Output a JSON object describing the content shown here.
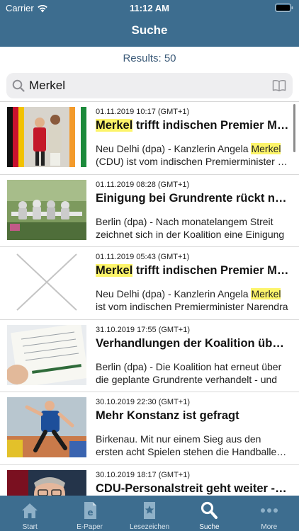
{
  "status_bar": {
    "carrier": "Carrier",
    "time": "11:12 AM"
  },
  "header": {
    "title": "Suche"
  },
  "results": {
    "label": "Results: 50"
  },
  "search": {
    "value": "Merkel"
  },
  "articles": [
    {
      "date": "01.11.2019 10:17 (GMT+1)",
      "title_hl": "Merkel",
      "title_rest": " trifft indischen Premier Modi",
      "excerpt1_pre": "Neu Delhi (dpa) - Kanzlerin Angela ",
      "excerpt1_hl": "Merkel",
      "excerpt2": "(CDU) ist vom indischen Premierminister Narendra"
    },
    {
      "date": "01.11.2019 08:28 (GMT+1)",
      "title_rest": "Einigung bei Grundrente rückt näher",
      "excerpt1_pre": "Berlin (dpa) - Nach monatelangem Streit",
      "excerpt2": "zeichnet sich in der Koalition eine Einigung"
    },
    {
      "date": "01.11.2019 05:43 (GMT+1)",
      "title_hl": "Merkel",
      "title_rest": " trifft indischen Premier Modi",
      "excerpt1_pre": "Neu Delhi (dpa) - Kanzlerin Angela ",
      "excerpt1_hl": "Merkel",
      "excerpt2": "ist vom indischen Premierminister Narendra"
    },
    {
      "date": "31.10.2019 17:55 (GMT+1)",
      "title_rest": "Verhandlungen der Koalition über Grundrente",
      "excerpt1_pre": "Berlin (dpa) - Die Koalition hat erneut über",
      "excerpt2": "die geplante Grundrente verhandelt - und"
    },
    {
      "date": "30.10.2019 22:30 (GMT+1)",
      "title_rest": "Mehr Konstanz ist gefragt",
      "excerpt1_pre": "Birkenau. Mit nur einem Sieg aus den",
      "excerpt2": "ersten acht Spielen stehen die Handballerinnen"
    },
    {
      "date": "30.10.2019 18:17 (GMT+1)",
      "title_rest": "CDU-Personalstreit geht weiter - Merz",
      "excerpt1_pre": "",
      "excerpt2": ""
    }
  ],
  "tabbar": {
    "items": [
      {
        "label": "Start",
        "icon": "home-icon"
      },
      {
        "label": "E-Paper",
        "icon": "epaper-icon"
      },
      {
        "label": "Lesezeichen",
        "icon": "bookmark-icon"
      },
      {
        "label": "Suche",
        "icon": "search-icon"
      },
      {
        "label": "More",
        "icon": "more-icon"
      }
    ]
  },
  "colors": {
    "primary": "#3d6d8f",
    "highlight": "#fcf46a",
    "results_text": "#3b5a78"
  }
}
